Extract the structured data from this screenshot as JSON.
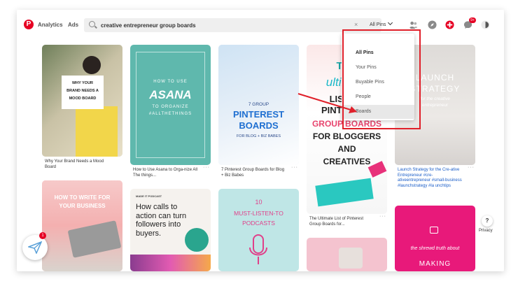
{
  "header": {
    "nav": {
      "analytics": "Analytics",
      "ads": "Ads"
    },
    "search": {
      "value": "creative entrepreneur group boards",
      "clear": "×"
    },
    "scope_label": "All Pins",
    "notification_count": "9+"
  },
  "dropdown": {
    "items": [
      "All Pins",
      "Your Pins",
      "Buyable Pins",
      "People",
      "Boards"
    ],
    "selected": "All Pins",
    "hovered": "Boards"
  },
  "pins": [
    {
      "title": "Why Your Brand Needs a Mood Board",
      "image_text": [
        "WHY YOUR",
        "BRAND NEEDS A",
        "MOOD BOARD"
      ]
    },
    {
      "title": "How to Use Asana to Orga-nize All The things...",
      "image_text": [
        "HOW TO USE",
        "ASANA",
        "TO ORGANIZE",
        "#ALLTHETHINGS"
      ]
    },
    {
      "title": "7 Pinterest Group Boards for Blog + Biz Babes",
      "image_text": [
        "7 GROUP",
        "PINTEREST",
        "BOARDS",
        "FOR BLOG + BIZ BABES"
      ]
    },
    {
      "title": "The Ultimate List of Pinterest Group Boards for...",
      "image_text": [
        "THE",
        "ultimate",
        "LIST OF",
        "PINTEREST",
        "GROUP BOARDS",
        "FOR BLOGGERS",
        "AND",
        "CREATIVES"
      ]
    },
    {
      "title": "Launch Strategy for the Cre-ative Entrepreneur #cre-ativeentrepreneur #small-business #launchstrategy #la unchtips",
      "image_text": [
        "LAUNCH",
        "STRATEGY",
        "for the creative",
        "entrepreneur"
      ]
    },
    {
      "title": "",
      "image_text": [
        "HOW TO WRITE FOR",
        "YOUR BUSINESS"
      ]
    },
    {
      "title": "",
      "image_text": [
        "MADE IT PODCAST",
        "How calls to action can turn followers into buyers."
      ]
    },
    {
      "title": "",
      "image_text": [
        "10",
        "MUST-LISTEN-TO",
        "PODCASTS"
      ]
    },
    {
      "title": "",
      "image_text": []
    },
    {
      "title": "",
      "image_text": [
        "the shrewd truth about",
        "MAKING"
      ]
    }
  ],
  "help": {
    "icon": "?",
    "privacy": "Privacy"
  },
  "floater_badge": "1",
  "colors": {
    "brand": "#e60023",
    "highlight": "#e0202a"
  }
}
